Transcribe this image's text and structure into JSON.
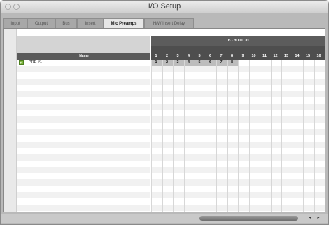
{
  "window": {
    "title": "I/O Setup"
  },
  "tabs": [
    {
      "label": "Input",
      "active": false
    },
    {
      "label": "Output",
      "active": false
    },
    {
      "label": "Bus",
      "active": false
    },
    {
      "label": "Insert",
      "active": false
    },
    {
      "label": "Mic Preamps",
      "active": true
    },
    {
      "label": "H/W Insert Delay",
      "active": false
    }
  ],
  "table": {
    "name_header": "Name",
    "device_header": "B - HD I/O #1",
    "channels": [
      "1",
      "2",
      "3",
      "4",
      "5",
      "6",
      "7",
      "8",
      "9",
      "10",
      "11",
      "12",
      "13",
      "14",
      "15",
      "16"
    ],
    "rows": [
      {
        "name": "PRE #1",
        "enabled": true,
        "assigned_channels": [
          "1",
          "2",
          "3",
          "4",
          "5",
          "6",
          "7",
          "8"
        ]
      }
    ]
  },
  "colors": {
    "checkbox": "#7db63d",
    "header_dark": "#4e4e4e",
    "assigned_cell": "#bdbdbd"
  }
}
